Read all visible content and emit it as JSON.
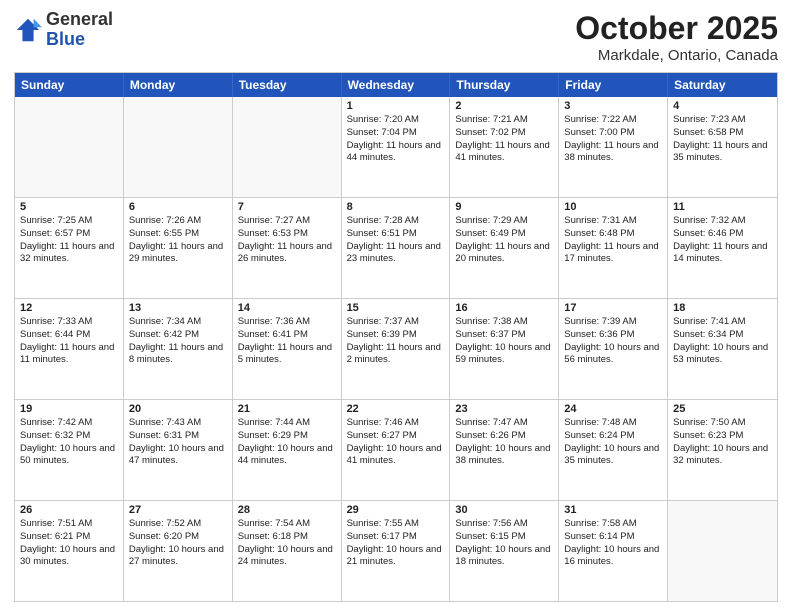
{
  "header": {
    "logo_line1": "General",
    "logo_line2": "Blue",
    "title": "October 2025",
    "subtitle": "Markdale, Ontario, Canada"
  },
  "days_of_week": [
    "Sunday",
    "Monday",
    "Tuesday",
    "Wednesday",
    "Thursday",
    "Friday",
    "Saturday"
  ],
  "weeks": [
    [
      {
        "day": "",
        "text": ""
      },
      {
        "day": "",
        "text": ""
      },
      {
        "day": "",
        "text": ""
      },
      {
        "day": "1",
        "text": "Sunrise: 7:20 AM\nSunset: 7:04 PM\nDaylight: 11 hours and 44 minutes."
      },
      {
        "day": "2",
        "text": "Sunrise: 7:21 AM\nSunset: 7:02 PM\nDaylight: 11 hours and 41 minutes."
      },
      {
        "day": "3",
        "text": "Sunrise: 7:22 AM\nSunset: 7:00 PM\nDaylight: 11 hours and 38 minutes."
      },
      {
        "day": "4",
        "text": "Sunrise: 7:23 AM\nSunset: 6:58 PM\nDaylight: 11 hours and 35 minutes."
      }
    ],
    [
      {
        "day": "5",
        "text": "Sunrise: 7:25 AM\nSunset: 6:57 PM\nDaylight: 11 hours and 32 minutes."
      },
      {
        "day": "6",
        "text": "Sunrise: 7:26 AM\nSunset: 6:55 PM\nDaylight: 11 hours and 29 minutes."
      },
      {
        "day": "7",
        "text": "Sunrise: 7:27 AM\nSunset: 6:53 PM\nDaylight: 11 hours and 26 minutes."
      },
      {
        "day": "8",
        "text": "Sunrise: 7:28 AM\nSunset: 6:51 PM\nDaylight: 11 hours and 23 minutes."
      },
      {
        "day": "9",
        "text": "Sunrise: 7:29 AM\nSunset: 6:49 PM\nDaylight: 11 hours and 20 minutes."
      },
      {
        "day": "10",
        "text": "Sunrise: 7:31 AM\nSunset: 6:48 PM\nDaylight: 11 hours and 17 minutes."
      },
      {
        "day": "11",
        "text": "Sunrise: 7:32 AM\nSunset: 6:46 PM\nDaylight: 11 hours and 14 minutes."
      }
    ],
    [
      {
        "day": "12",
        "text": "Sunrise: 7:33 AM\nSunset: 6:44 PM\nDaylight: 11 hours and 11 minutes."
      },
      {
        "day": "13",
        "text": "Sunrise: 7:34 AM\nSunset: 6:42 PM\nDaylight: 11 hours and 8 minutes."
      },
      {
        "day": "14",
        "text": "Sunrise: 7:36 AM\nSunset: 6:41 PM\nDaylight: 11 hours and 5 minutes."
      },
      {
        "day": "15",
        "text": "Sunrise: 7:37 AM\nSunset: 6:39 PM\nDaylight: 11 hours and 2 minutes."
      },
      {
        "day": "16",
        "text": "Sunrise: 7:38 AM\nSunset: 6:37 PM\nDaylight: 10 hours and 59 minutes."
      },
      {
        "day": "17",
        "text": "Sunrise: 7:39 AM\nSunset: 6:36 PM\nDaylight: 10 hours and 56 minutes."
      },
      {
        "day": "18",
        "text": "Sunrise: 7:41 AM\nSunset: 6:34 PM\nDaylight: 10 hours and 53 minutes."
      }
    ],
    [
      {
        "day": "19",
        "text": "Sunrise: 7:42 AM\nSunset: 6:32 PM\nDaylight: 10 hours and 50 minutes."
      },
      {
        "day": "20",
        "text": "Sunrise: 7:43 AM\nSunset: 6:31 PM\nDaylight: 10 hours and 47 minutes."
      },
      {
        "day": "21",
        "text": "Sunrise: 7:44 AM\nSunset: 6:29 PM\nDaylight: 10 hours and 44 minutes."
      },
      {
        "day": "22",
        "text": "Sunrise: 7:46 AM\nSunset: 6:27 PM\nDaylight: 10 hours and 41 minutes."
      },
      {
        "day": "23",
        "text": "Sunrise: 7:47 AM\nSunset: 6:26 PM\nDaylight: 10 hours and 38 minutes."
      },
      {
        "day": "24",
        "text": "Sunrise: 7:48 AM\nSunset: 6:24 PM\nDaylight: 10 hours and 35 minutes."
      },
      {
        "day": "25",
        "text": "Sunrise: 7:50 AM\nSunset: 6:23 PM\nDaylight: 10 hours and 32 minutes."
      }
    ],
    [
      {
        "day": "26",
        "text": "Sunrise: 7:51 AM\nSunset: 6:21 PM\nDaylight: 10 hours and 30 minutes."
      },
      {
        "day": "27",
        "text": "Sunrise: 7:52 AM\nSunset: 6:20 PM\nDaylight: 10 hours and 27 minutes."
      },
      {
        "day": "28",
        "text": "Sunrise: 7:54 AM\nSunset: 6:18 PM\nDaylight: 10 hours and 24 minutes."
      },
      {
        "day": "29",
        "text": "Sunrise: 7:55 AM\nSunset: 6:17 PM\nDaylight: 10 hours and 21 minutes."
      },
      {
        "day": "30",
        "text": "Sunrise: 7:56 AM\nSunset: 6:15 PM\nDaylight: 10 hours and 18 minutes."
      },
      {
        "day": "31",
        "text": "Sunrise: 7:58 AM\nSunset: 6:14 PM\nDaylight: 10 hours and 16 minutes."
      },
      {
        "day": "",
        "text": ""
      }
    ]
  ]
}
